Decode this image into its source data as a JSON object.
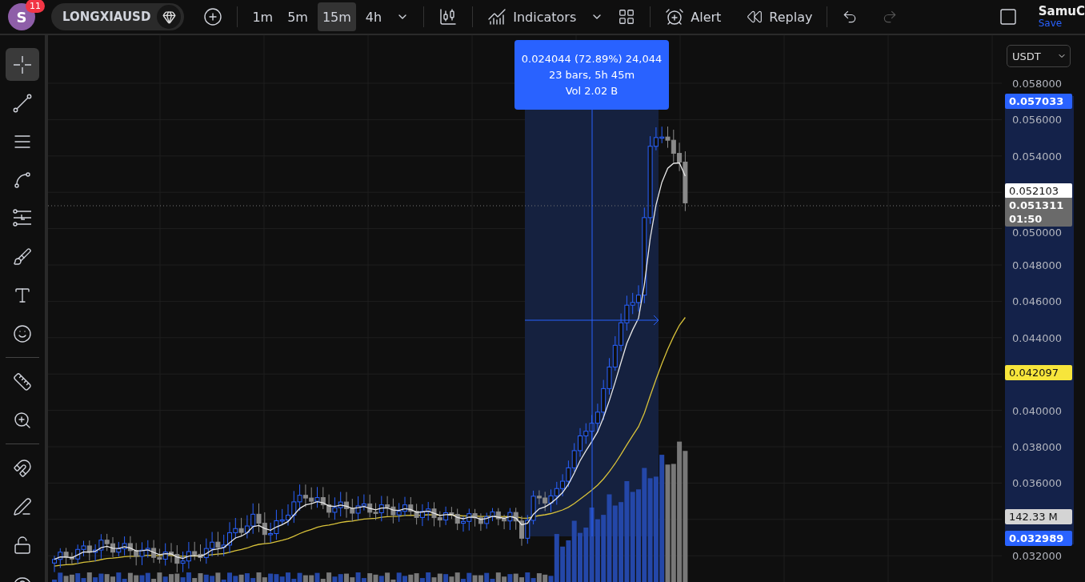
{
  "top_bar": {
    "avatar": {
      "letter": "S",
      "badge": "11"
    },
    "symbol": "LONGXIAUSD",
    "timeframes": [
      {
        "label": "1m",
        "selected": false
      },
      {
        "label": "5m",
        "selected": false
      },
      {
        "label": "15m",
        "selected": true
      },
      {
        "label": "4h",
        "selected": false
      }
    ],
    "indicators": "Indicators",
    "alert": "Alert",
    "replay": "Replay",
    "user": {
      "name": "SamuC",
      "status": "Save"
    }
  },
  "tool_groups": [
    [
      {
        "kind": "crosshair",
        "selected": true
      },
      {
        "kind": "trend-line",
        "selected": false
      },
      {
        "kind": "fib",
        "selected": false
      },
      {
        "kind": "pattern",
        "selected": false
      },
      {
        "kind": "projection",
        "selected": false
      },
      {
        "kind": "brush",
        "selected": false
      },
      {
        "kind": "text",
        "selected": false
      },
      {
        "kind": "emoji",
        "selected": false
      }
    ],
    [
      {
        "kind": "ruler",
        "selected": false
      },
      {
        "kind": "zoom",
        "selected": false
      }
    ],
    [
      {
        "kind": "magnet",
        "selected": false
      },
      {
        "kind": "lock-drawing",
        "selected": false
      },
      {
        "kind": "unlock",
        "selected": false
      },
      {
        "kind": "eye",
        "selected": false
      }
    ]
  ],
  "measure": {
    "lines": [
      "0.024044 (72.89%) 24,044",
      "23 bars, 5h 45m",
      "Vol 2.02 B"
    ]
  },
  "price_axis": {
    "currency": "USDT",
    "ticks": [
      "0.058000",
      "0.056000",
      "0.054000",
      "0.050000",
      "0.048000",
      "0.046000",
      "0.044000",
      "0.040000",
      "0.038000",
      "0.036000",
      "0.032000"
    ],
    "badges": [
      {
        "kind": "price",
        "label": "0.057033",
        "color": "#2962ff"
      },
      {
        "kind": "price",
        "label": "0.052103",
        "color": "#ffffff"
      },
      {
        "kind": "price",
        "label": "0.051311",
        "countdown": "01:50",
        "color": "#6a6a6a"
      },
      {
        "kind": "price",
        "label": "0.042097",
        "color": "#f7e53b"
      },
      {
        "kind": "volume",
        "label": "142.33 M",
        "color": "#d4d4d4"
      },
      {
        "kind": "price",
        "label": "0.032989",
        "color": "#2962ff"
      }
    ]
  }
}
